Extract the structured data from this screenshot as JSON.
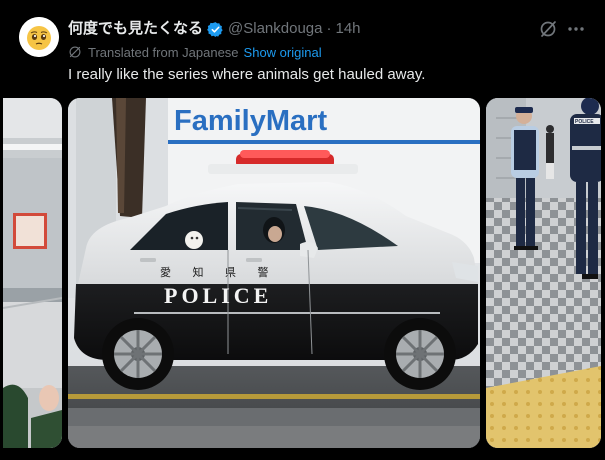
{
  "post": {
    "display_name": "何度でも見たくなる",
    "handle": "@Slankdouga",
    "separator": "·",
    "timestamp": "14h",
    "translated_label": "Translated from Japanese",
    "show_original_label": "Show original",
    "text": "I really like the series where animals get hauled away."
  },
  "media": {
    "main_store_sign": "FamilyMart",
    "main_car_text": "POLICE",
    "main_door_kanji": "愛 知 県 警",
    "right_vest_text": "POLICE"
  },
  "icons": {
    "verified": "verified-badge-icon",
    "grok": "grok-icon",
    "more": "more-icon",
    "translate": "translate-icon"
  },
  "colors": {
    "background": "#000000",
    "text_primary": "#e7e9ea",
    "text_secondary": "#71767b",
    "accent": "#1d9bf0"
  }
}
